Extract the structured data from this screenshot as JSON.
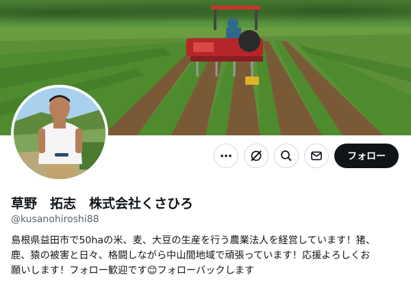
{
  "profile": {
    "name": "草野　拓志　株式会社くさひろ",
    "handle": "@kusanohiroshi88",
    "bio": "島根県益田市で50haの米、麦、大豆の生産を行う農業法人を経営しています！猪、\n鹿、猿の被害と日々、格闘しながら中山間地域で頑張っています！応援よろしくお\n願いします！フォロー歓迎です😊フォローバックします"
  },
  "actions": {
    "more_icon": "more-icon",
    "grok_icon": "grok-icon",
    "search_icon": "search-icon",
    "message_icon": "mail-icon",
    "follow_label": "フォロー"
  },
  "colors": {
    "follow_bg": "#0f1419",
    "text": "#0f1419",
    "secondary": "#536471",
    "border": "#cfd9de"
  }
}
